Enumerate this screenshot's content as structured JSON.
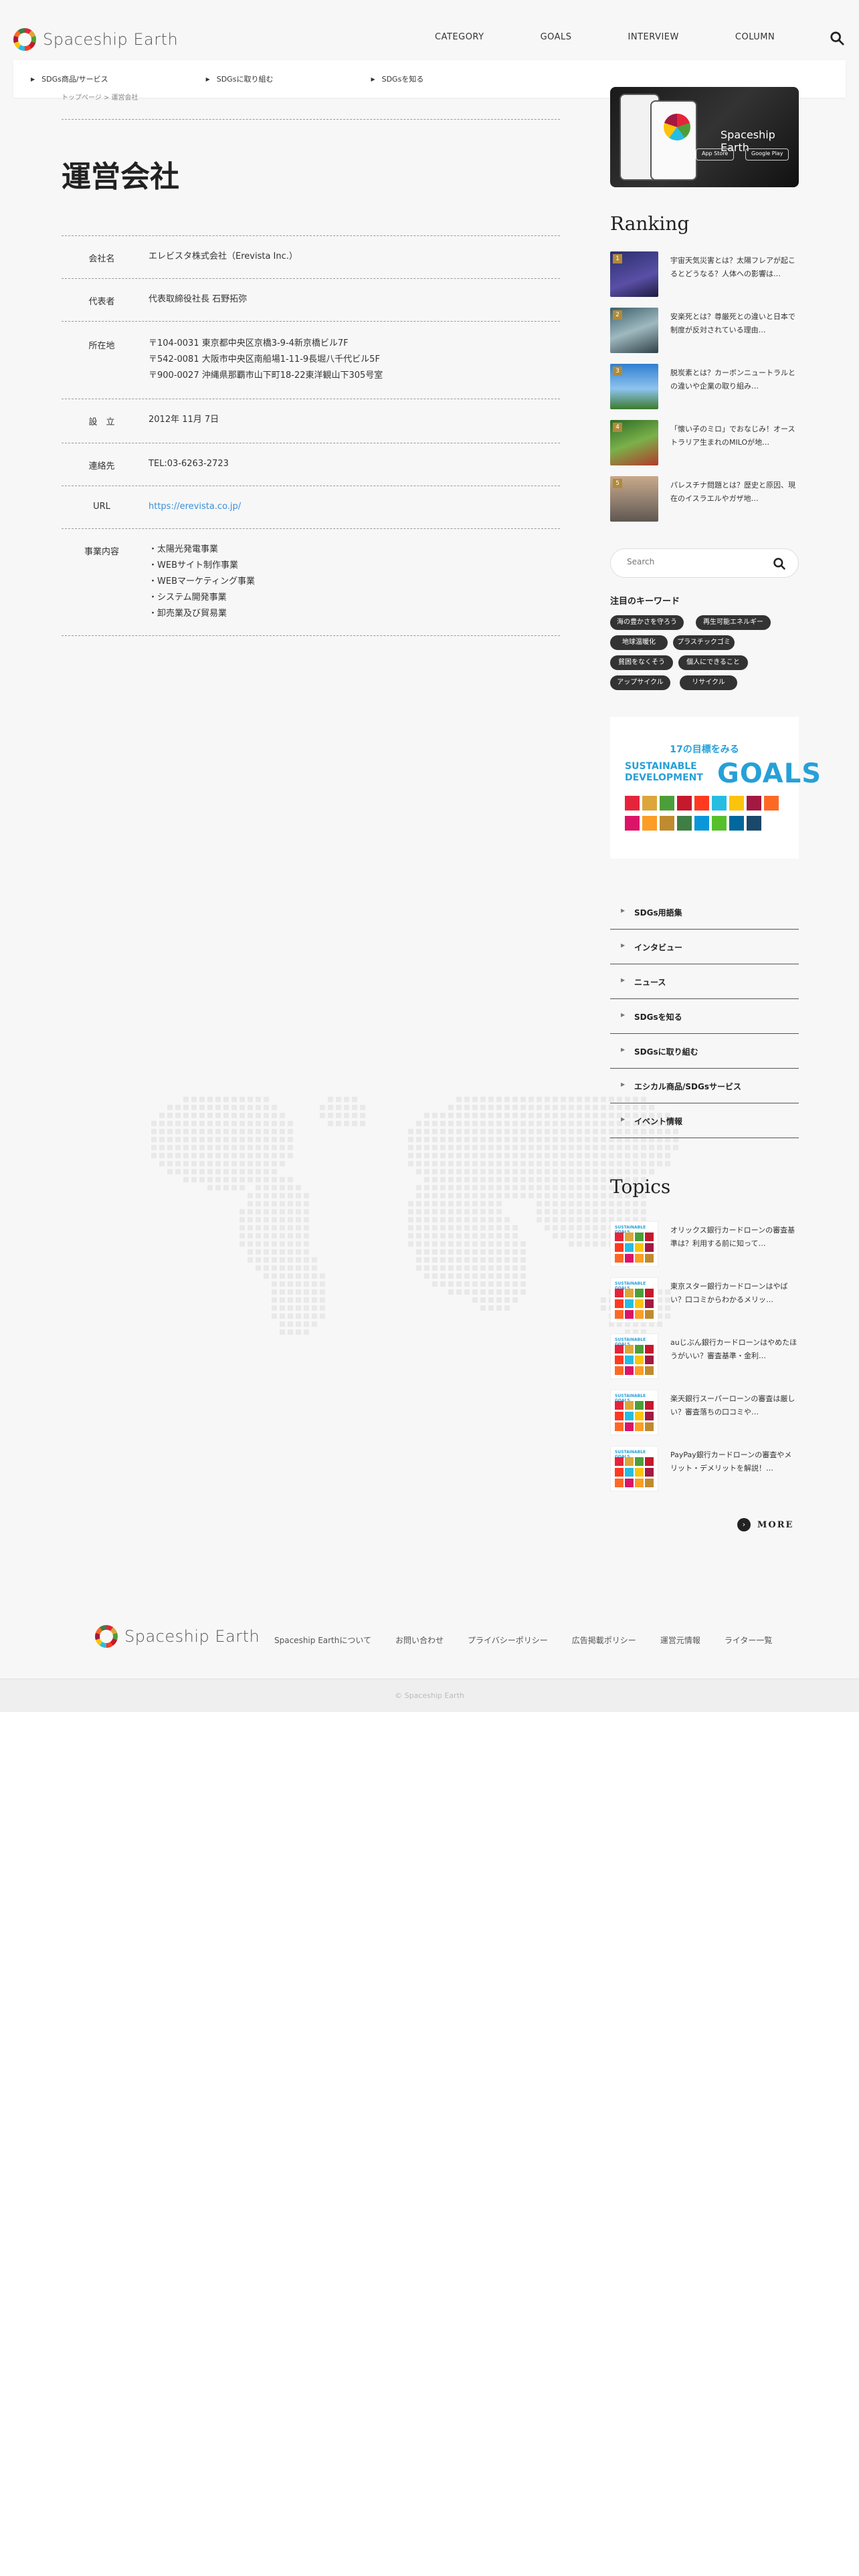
{
  "header": {
    "logo_text": "Spaceship Earth",
    "nav": [
      "CATEGORY",
      "GOALS",
      "INTERVIEW",
      "COLUMN"
    ],
    "subnav": [
      "SDGs商品/サービス",
      "SDGsに取り組む",
      "SDGsを知る"
    ]
  },
  "breadcrumb": "トップページ > 運営会社",
  "page": {
    "title": "運営会社",
    "rows": [
      {
        "label": "会社名",
        "value": [
          "エレビスタ株式会社（Erevista Inc.）"
        ]
      },
      {
        "label": "代表者",
        "value": [
          "代表取締役社長 石野拓弥"
        ]
      },
      {
        "label": "所在地",
        "value": [
          "〒104-0031 東京都中央区京橋3-9-4新京橋ビル7F",
          "〒542-0081 大阪市中央区南船場1-11-9長堀八千代ビル5F",
          "〒900-0027 沖縄県那覇市山下町18-22東洋観山下305号室"
        ]
      },
      {
        "label": "設　立",
        "value": [
          "2012年 11月 7日"
        ]
      },
      {
        "label": "連絡先",
        "value": [
          "TEL:03-6263-2723"
        ]
      },
      {
        "label": "URL",
        "value": [
          "https://erevista.co.jp/"
        ]
      },
      {
        "label": "事業内容",
        "value": [
          "・太陽光発電事業",
          "・WEBサイト制作事業",
          "・WEBマーケティング事業",
          "・システム開発事業",
          "・卸売業及び貿易業"
        ]
      }
    ]
  },
  "sidebar": {
    "app_banner_title": "Spaceship Earth",
    "app_store": "App Store",
    "google_play": "Google Play",
    "ranking_title": "Ranking",
    "ranking": [
      {
        "rank": "1",
        "text": "宇宙天気災害とは？太陽フレアが起こるとどうなる？人体への影響は…"
      },
      {
        "rank": "2",
        "text": "安楽死とは？尊厳死との違いと日本で制度が反対されている理由…"
      },
      {
        "rank": "3",
        "text": "脱炭素とは？カーボンニュートラルとの違いや企業の取り組み…"
      },
      {
        "rank": "4",
        "text": "「懐い子のミロ」でおなじみ！オーストラリア生まれのMILOが地…"
      },
      {
        "rank": "5",
        "text": "パレスチナ問題とは？歴史と原因、現在のイスラエルやガザ地…"
      }
    ],
    "search_placeholder": "Search",
    "keywords_title": "注目のキーワード",
    "keywords": [
      "海の豊かさを守ろう",
      "再生可能エネルギー",
      "地球温暖化",
      "プラスチックゴミ",
      "貧困をなくそう",
      "個人にできること",
      "アップサイクル",
      "リサイクル"
    ],
    "goals_banner": {
      "line1": "17の目標をみる",
      "line2": "SUSTAINABLE",
      "line3": "DEVELOPMENT",
      "line4": "GOALS"
    },
    "menu": [
      "SDGs用語集",
      "インタビュー",
      "ニュース",
      "SDGsを知る",
      "SDGsに取り組む",
      "エシカル商品/SDGsサービス",
      "イベント情報"
    ],
    "topics_title": "Topics",
    "topics": [
      "オリックス銀行カードローンの審査基準は？利用する前に知って…",
      "東京スター銀行カードローンはやばい？口コミからわかるメリッ…",
      "auじぶん銀行カードローンはやめたほうがいい？審査基準・金利…",
      "楽天銀行スーパーローンの審査は厳しい？審査落ちの口コミや…",
      "PayPay銀行カードローンの審査やメリット・デメリットを解説！…"
    ],
    "topic_thumb_label": "SUSTAINABLE GOALS",
    "more": "MORE"
  },
  "footer": {
    "logo_text": "Spaceship Earth",
    "links": [
      "Spaceship Earthについて",
      "お問い合わせ",
      "プライバシーポリシー",
      "広告掲載ポリシー",
      "運営元情報",
      "ライター一覧"
    ],
    "copyright": "© Spaceship Earth"
  },
  "colors": {
    "accent": "#26a0d8",
    "link": "#3a8fd8",
    "tag_bg": "#333333",
    "background": "#f7f7f7"
  }
}
